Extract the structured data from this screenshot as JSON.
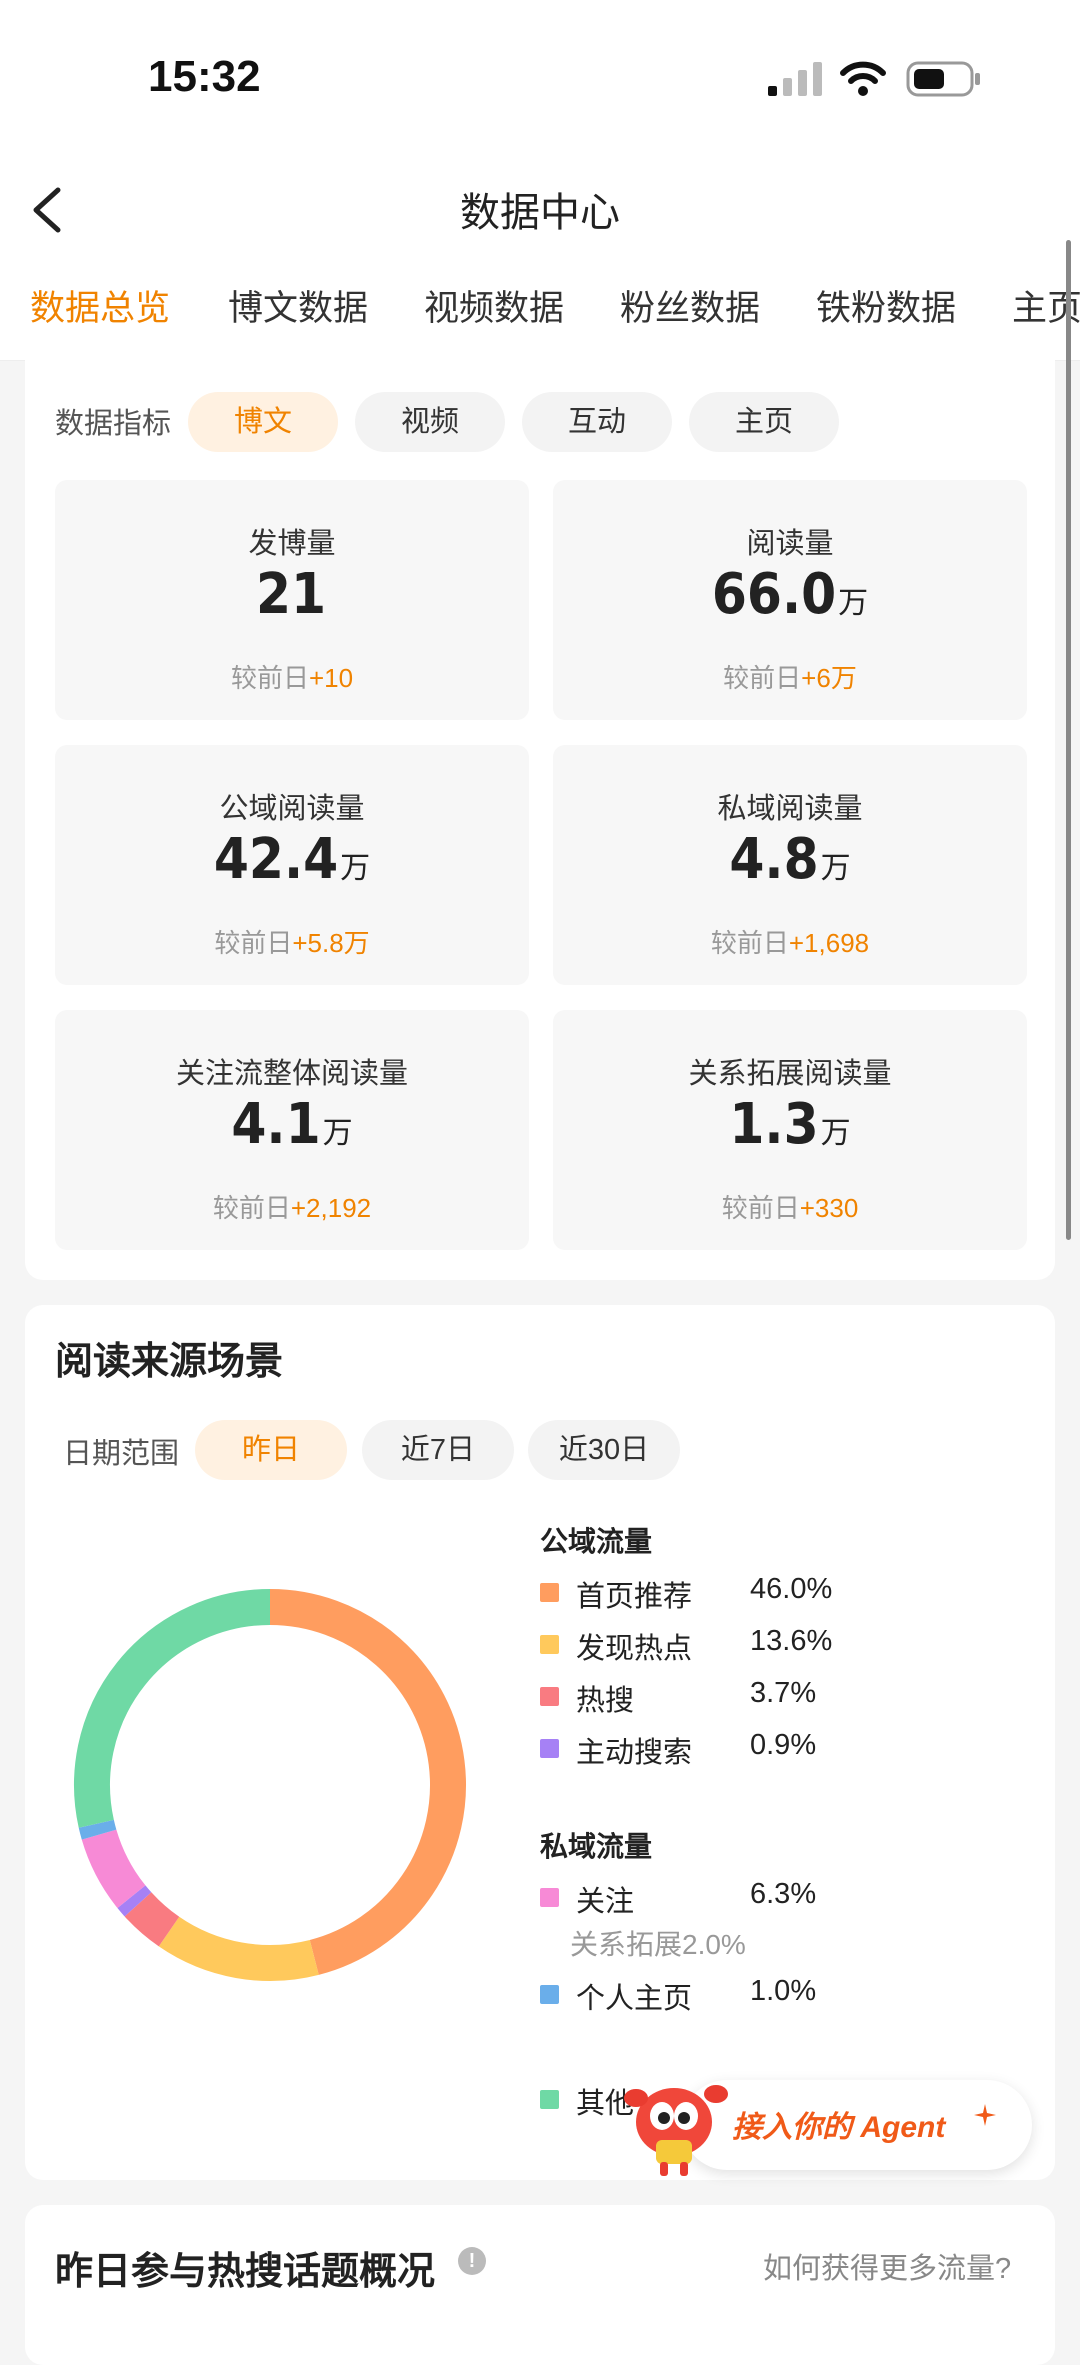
{
  "status_bar": {
    "time": "15:32"
  },
  "header": {
    "title": "数据中心"
  },
  "tabs": [
    {
      "label": "数据总览"
    },
    {
      "label": "博文数据"
    },
    {
      "label": "视频数据"
    },
    {
      "label": "粉丝数据"
    },
    {
      "label": "铁粉数据"
    },
    {
      "label": "主页"
    }
  ],
  "overview": {
    "filter_label": "数据指标",
    "filters": [
      "博文",
      "视频",
      "互动",
      "主页"
    ],
    "compare_prefix": "较前日",
    "metrics": [
      {
        "label": "发博量",
        "value": "21",
        "unit": "",
        "delta": "+10"
      },
      {
        "label": "阅读量",
        "value": "66.0",
        "unit": "万",
        "delta": "+6万"
      },
      {
        "label": "公域阅读量",
        "value": "42.4",
        "unit": "万",
        "delta": "+5.8万"
      },
      {
        "label": "私域阅读量",
        "value": "4.8",
        "unit": "万",
        "delta": "+1,698"
      },
      {
        "label": "关注流整体阅读量",
        "value": "4.1",
        "unit": "万",
        "delta": "+2,192"
      },
      {
        "label": "关系拓展阅读量",
        "value": "1.3",
        "unit": "万",
        "delta": "+330"
      }
    ]
  },
  "source": {
    "title": "阅读来源场景",
    "date_label": "日期范围",
    "ranges": [
      "昨日",
      "近7日",
      "近30日"
    ],
    "public_head": "公域流量",
    "private_head": "私域流量",
    "public_items": [
      {
        "name": "首页推荐",
        "value": "46.0%",
        "color": "#ff9d5f"
      },
      {
        "name": "发现热点",
        "value": "13.6%",
        "color": "#ffc95c"
      },
      {
        "name": "热搜",
        "value": "3.7%",
        "color": "#f97b81"
      },
      {
        "name": "主动搜索",
        "value": "0.9%",
        "color": "#a681f5"
      }
    ],
    "private_items": [
      {
        "name": "关注",
        "value": "6.3%",
        "color": "#f78ad6"
      },
      {
        "name": "个人主页",
        "value": "1.0%",
        "color": "#6aaeea"
      }
    ],
    "follow_sub": "关系拓展2.0%",
    "other": {
      "name": "其他",
      "color": "#6fd9a5"
    }
  },
  "chart_data": {
    "type": "pie",
    "series": [
      {
        "name": "首页推荐",
        "value": 46.0,
        "color": "#ff9d5f"
      },
      {
        "name": "发现热点",
        "value": 13.6,
        "color": "#ffc95c"
      },
      {
        "name": "热搜",
        "value": 3.7,
        "color": "#f97b81"
      },
      {
        "name": "主动搜索",
        "value": 0.9,
        "color": "#a681f5"
      },
      {
        "name": "关注",
        "value": 6.3,
        "color": "#f78ad6"
      },
      {
        "name": "个人主页",
        "value": 1.0,
        "color": "#6aaeea"
      },
      {
        "name": "其他",
        "value": 28.5,
        "color": "#6fd9a5"
      }
    ]
  },
  "agent": {
    "label": "接入你的 Agent"
  },
  "hot_topics": {
    "title": "昨日参与热搜话题概况",
    "info": "!",
    "link": "如何获得更多流量?"
  }
}
